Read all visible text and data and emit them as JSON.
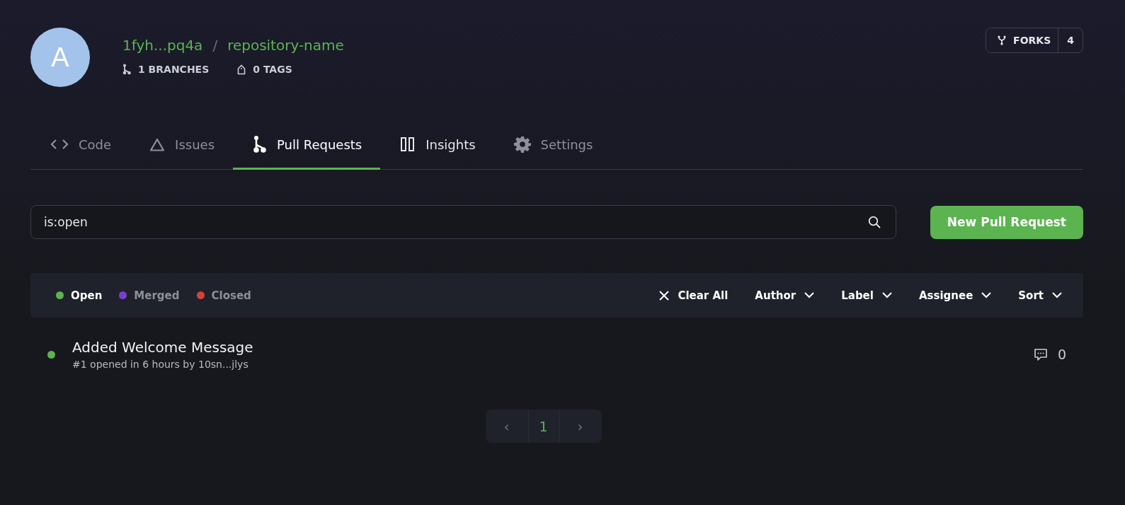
{
  "repo": {
    "avatar_letter": "A",
    "owner": "1fyh...pq4a",
    "separator": "/",
    "name": "repository-name",
    "branches": "1 BRANCHES",
    "tags": "0 TAGS"
  },
  "forks": {
    "label": "FORKS",
    "count": "4"
  },
  "tabs": [
    {
      "kind": "code",
      "label": "Code",
      "selected": false,
      "disabled": true
    },
    {
      "kind": "issues",
      "label": "Issues",
      "selected": false,
      "disabled": true
    },
    {
      "kind": "pulls",
      "label": "Pull Requests",
      "selected": true,
      "disabled": false
    },
    {
      "kind": "insights",
      "label": "Insights",
      "selected": false,
      "disabled": false
    },
    {
      "kind": "settings",
      "label": "Settings",
      "selected": false,
      "disabled": true
    }
  ],
  "search": {
    "value": "is:open"
  },
  "new_button": "New Pull Request",
  "status_filters": [
    {
      "label": "Open",
      "color": "#5bb450",
      "selected": true
    },
    {
      "label": "Merged",
      "color": "#7b3fd0",
      "selected": false
    },
    {
      "label": "Closed",
      "color": "#d0443a",
      "selected": false
    }
  ],
  "clear_all": "Clear All",
  "dropdowns": [
    "Author",
    "Label",
    "Assignee",
    "Sort"
  ],
  "pull_requests": [
    {
      "title": "Added Welcome Message",
      "meta": "#1 opened in 6 hours by 10sn...jlys",
      "color": "#5bb450",
      "comments": "0"
    }
  ],
  "pagination": {
    "prev": "‹",
    "pages": [
      {
        "label": "1",
        "selected": true
      }
    ],
    "next": "›"
  }
}
